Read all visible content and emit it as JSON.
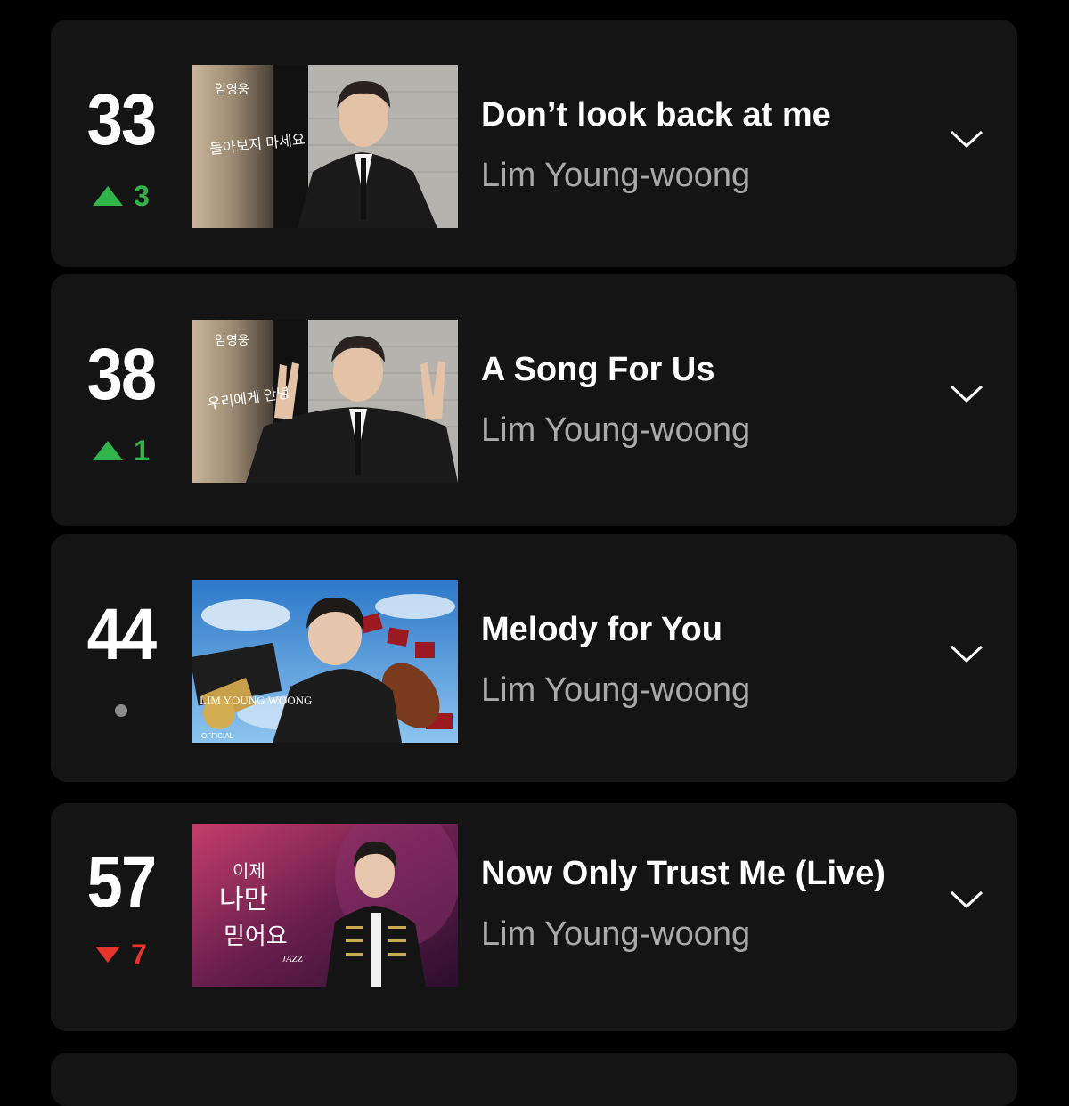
{
  "entries": [
    {
      "rank": "33",
      "change_dir": "up",
      "change": "3",
      "title": "Don’t look back at me",
      "artist": "Lim Young-woong",
      "thumb_text": "돌아보지 마세요",
      "thumb_corner": "임영웅"
    },
    {
      "rank": "38",
      "change_dir": "up",
      "change": "1",
      "title": "A Song For Us",
      "artist": "Lim Young-woong",
      "thumb_text": "우리에게 안녕",
      "thumb_corner": "임영웅"
    },
    {
      "rank": "44",
      "change_dir": "same",
      "change": "",
      "title": "Melody for You",
      "artist": "Lim Young-woong",
      "thumb_text": "LIM YOUNG WOONG",
      "thumb_sub": "OFFICIAL"
    },
    {
      "rank": "57",
      "change_dir": "down",
      "change": "7",
      "title": "Now Only Trust Me (Live)",
      "artist": "Lim Young-woong",
      "thumb_text_1": "이제",
      "thumb_text_2": "나만",
      "thumb_text_3": "믿어요",
      "thumb_sub": "JAZZ"
    }
  ],
  "colors": {
    "up": "#2fb54a",
    "down": "#e6362c",
    "card": "#141414",
    "artist": "#a9a9a9"
  },
  "icons": {
    "expand": "chevron-down-icon"
  }
}
